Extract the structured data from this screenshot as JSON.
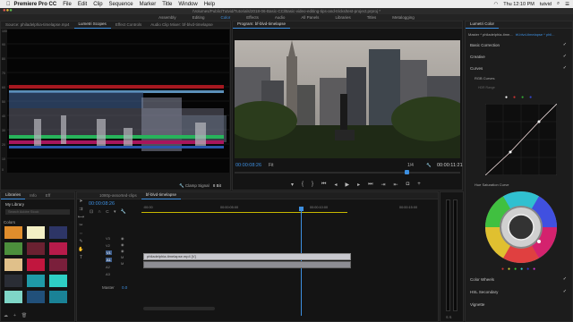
{
  "menubar": {
    "apple": "",
    "app_name": "Premiere Pro CC",
    "menus": [
      "File",
      "Edit",
      "Clip",
      "Sequence",
      "Marker",
      "Title",
      "Window",
      "Help"
    ],
    "clock": "Thu 12:10 PM",
    "user": "tutvid"
  },
  "titlebar": {
    "path": "/Volumes/Public/Tutvid/Tutorials/2018-06-Basic-CC/Basic-video-editing-tips-and-tricks/test-project.prproj *"
  },
  "workspaces": [
    "Assembly",
    "Editing",
    "Color",
    "Effects",
    "Audio",
    "All Panels",
    "Libraries",
    "Titles",
    "Metalogging"
  ],
  "active_workspace": "Color",
  "scopes": {
    "tabs": [
      "Source: philadelphia-timelapse.mp4",
      "Lumetri Scopes",
      "Effect Controls",
      "Audio Clip Mixer: bf-blvd-timelapse"
    ],
    "active_tab": "Lumetri Scopes",
    "y_labels": [
      "100",
      "90",
      "80",
      "70",
      "60",
      "50",
      "40",
      "30",
      "20",
      "10",
      "0"
    ],
    "clamp_label": "Clamp Signal",
    "bit_depth": "8 Bit"
  },
  "program": {
    "title": "Program: bf-blvd-timelapse",
    "timecode": "00:00:08:26",
    "fit": "Fit",
    "resolution": "1/4",
    "duration": "00:00:11:21"
  },
  "libraries": {
    "tabs": [
      "Libraries",
      "Info",
      "Eff"
    ],
    "library_name": "My Library",
    "search_placeholder": "Search Adobe Stock",
    "section": "Colors",
    "colors": [
      "#e08d2c",
      "#f3efc4",
      "#2d3566",
      "#4c8f3c",
      "#6b2131",
      "#b71b4a",
      "#e0c08a",
      "#c1163e",
      "#7a1f3b",
      "#2a2d35",
      "#1f9aa7",
      "#2ecfc4",
      "#7fd6c7",
      "#21507a",
      "#1a8296"
    ]
  },
  "timeline": {
    "tabs": [
      "1080p-assorted-clips",
      "bf-blvd-timelapse"
    ],
    "active_tab": "bf-blvd-timelapse",
    "timecode": "00:00:08:26",
    "ruler": [
      ":00:00",
      "00:00:05:00",
      "00:00:10:00",
      "00:00:15:00"
    ],
    "tracks": [
      "V3",
      "V2",
      "V1",
      "A1",
      "A2",
      "A3"
    ],
    "video_clip": "philadelphia-timelapse.mp4 [V]",
    "master_label": "Master",
    "master_value": "0.0"
  },
  "lumetri": {
    "title": "Lumetri Color",
    "source_label": "Master * philadelphia-time...",
    "seq_label": "bf-blvd-timelapse * phil...",
    "sections": [
      "Basic Correction",
      "Creative",
      "Curves"
    ],
    "rgb_curves": "RGB Curves",
    "hdr_range": "HDR Range",
    "hue_sat": "Hue Saturation Curve",
    "bottom_sections": [
      "Color Wheels",
      "HSL Secondary",
      "Vignette"
    ]
  }
}
